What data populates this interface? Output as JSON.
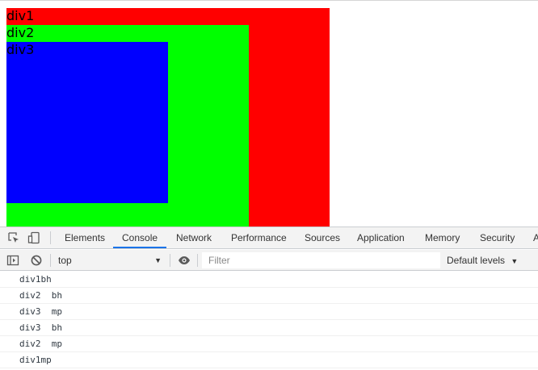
{
  "page": {
    "div1_label": "div1",
    "div2_label": "div2",
    "div3_label": "div3",
    "colors": {
      "div1": "#ff0000",
      "div2": "#00ff00",
      "div3": "#0000ff"
    }
  },
  "devtools": {
    "tabs": [
      "Elements",
      "Console",
      "Network",
      "Performance",
      "Sources",
      "Application",
      "Memory",
      "Security",
      "A"
    ],
    "active_tab": "Console",
    "context": "top",
    "filter_placeholder": "Filter",
    "levels": "Default levels",
    "icons": [
      "inspect-element-icon",
      "device-toolbar-icon",
      "show-sidebar-icon",
      "clear-console-icon",
      "eye-icon",
      "dropdown-arrow-icon"
    ]
  },
  "console": {
    "lines": [
      "div1bh",
      "div2  bh",
      "div3  mp",
      "div3  bh",
      "div2  mp",
      "div1mp"
    ]
  }
}
